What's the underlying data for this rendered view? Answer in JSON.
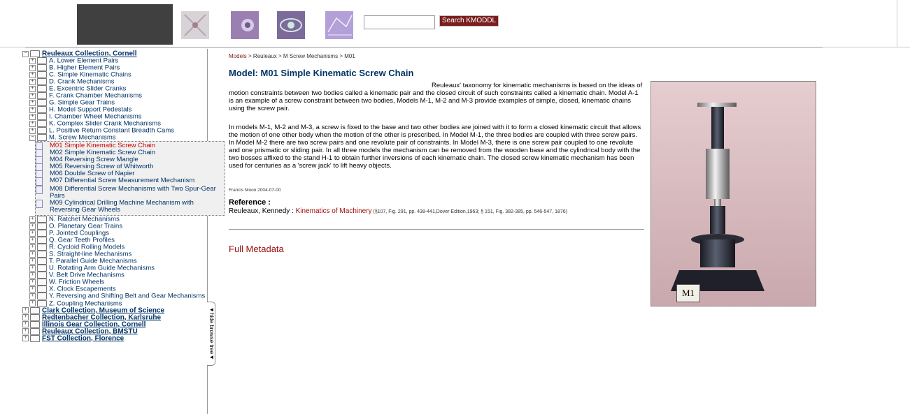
{
  "header": {
    "search_placeholder": "",
    "search_button_label": "Search KMODDL"
  },
  "tree": {
    "root": "Reuleaux Collection, Cornell",
    "categories": [
      "A. Lower Element Pairs",
      "B. Higher Element Pairs",
      "C. Simple Kinematic Chains",
      "D. Crank Mechanisms",
      "E. Excentric Slider Cranks",
      "F. Crank Chamber Mechanisms",
      "G. Simple Gear Trains",
      "H. Model Support Pedestals",
      "I. Chamber Wheel Mechanisms",
      "K. Complex Slider Crank Mechanisms",
      "L. Positive Return Constant Breadth Cams",
      "M. Screw Mechanisms"
    ],
    "screw_items": [
      "M01 Simple Kinematic Screw Chain",
      "M02 Simple Kinematic Screw Chain",
      "M04 Reversing Screw Mangle",
      "M05 Reversing Screw of Whitworth",
      "M06 Double Screw of Napier",
      "M07 Differential Screw Measurement Mechanism",
      "M08 Differential Screw Mechanisms with Two Spur-Gear Pairs",
      "M09 Cylindrical Drilling Machine Mechanism with Reversing Gear Wheels"
    ],
    "categories_after": [
      "N. Ratchet Mechanisms",
      "O. Planetary Gear Trains",
      "P. Jointed Couplings",
      "Q. Gear Teeth Profiles",
      "R. Cycloid Rolling Models",
      "S. Straight-line Mechanisms",
      "T. Parallel Guide Mechanisms",
      "U. Rotating Arm Guide Mechanisms",
      "V. Belt Drive Mechanisms",
      "W. Friction Wheels",
      "X. Clock Escapements",
      "Y. Reversing and Shifting Belt and Gear Mechanisms",
      "Z. Coupling Mechanisms"
    ],
    "other_roots": [
      "Clark Collection, Museum of Science",
      "Redtenbacher Collection, Karlsruhe",
      "Illinois Gear Collection, Cornell",
      "Reuleaux Collection, BMSTU",
      "FST Collection, Florence"
    ],
    "hide_tab_label": "◄hide browse tree◄"
  },
  "main": {
    "breadcrumb": [
      "Models",
      "Reuleaux",
      "M Screw Mechanisms",
      "M01"
    ],
    "breadcrumb_sep": " > ",
    "title": "Model: M01 Simple Kinematic Screw Chain",
    "para1": "Reuleaux' taxonomy for kinematic mechanisms is based on the ideas of motion constraints between two bodies called a kinematic pair and the closed circuit of such constraints called a kinematic chain. Model A-1 is an example of a screw constraint between two bodies, Models M-1, M-2 and M-3 provide examples of simple, closed, kinematic chains using the screw pair.",
    "para2": "In models M-1, M-2 and M-3, a screw is fixed to the base and two other bodies are joined with it to form a closed kinematic circuit that allows the motion of one other body when the motion of the other is prescribed. In Model M-1, the three bodies are coupled with three screw pairs. In Model M-2 there are two screw pairs and one revolute pair of constraints. In Model M-3, there is one screw pair coupled to one revolute and one prismatic or sliding pair. In all three models the mechanism can be removed from the wooden base and the cylindrical body with the two bosses affixed to the stand H-1 to obtain further inversions of each kinematic chain. The closed screw kinematic mechanism has been used for centuries as a 'screw jack' to lift heavy objects.",
    "author": "Francis Moon 2004-07-00",
    "reference_heading": "Reference :",
    "reference_author": "Reuleaux, Kennedy : ",
    "reference_title": "Kinematics of Machinery",
    "reference_detail": " (§107, Fig. 291, pp. 438-441,Dover Edition,1963; § 151, Fig. 382-385, pp. 546-547, 1876)",
    "full_metadata": "Full Metadata",
    "photo_label": "M1"
  }
}
